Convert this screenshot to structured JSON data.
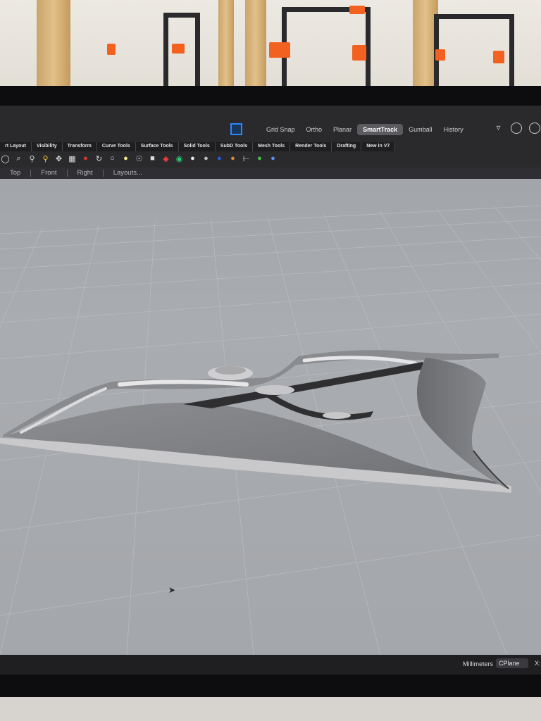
{
  "toolbar": {
    "toggles": [
      "Grid Snap",
      "Ortho",
      "Planar",
      "SmartTrack",
      "Gumball",
      "History"
    ],
    "active_toggle": "SmartTrack"
  },
  "tabs": [
    "rt Layout",
    "Visibility",
    "Transform",
    "Curve Tools",
    "Surface Tools",
    "Solid Tools",
    "SubD Tools",
    "Mesh Tools",
    "Render Tools",
    "Drafting",
    "New in V7"
  ],
  "tool_icons": [
    "circle-icon",
    "zoom-extents-icon",
    "zoom-window-icon",
    "zoom-icon",
    "pan-icon",
    "grid-viewport-icon",
    "car-icon",
    "rotate-icon",
    "select-icon",
    "light-icon",
    "lock-icon",
    "material-icon",
    "color-wheel-icon",
    "sphere-icon",
    "render-sphere-icon",
    "blue-sphere-icon",
    "orange-sphere-icon",
    "measure-icon",
    "check-icon",
    "help-icon"
  ],
  "viewport_tabs": [
    "Top",
    "Front",
    "Right",
    "Layouts..."
  ],
  "status": {
    "units": "Millimeters",
    "cplane": "CPlane",
    "coord_label": "X:"
  },
  "colors": {
    "accent": "#2e86ff",
    "model": "#7c7d80",
    "viewport_bg": "#a6a9ad"
  }
}
